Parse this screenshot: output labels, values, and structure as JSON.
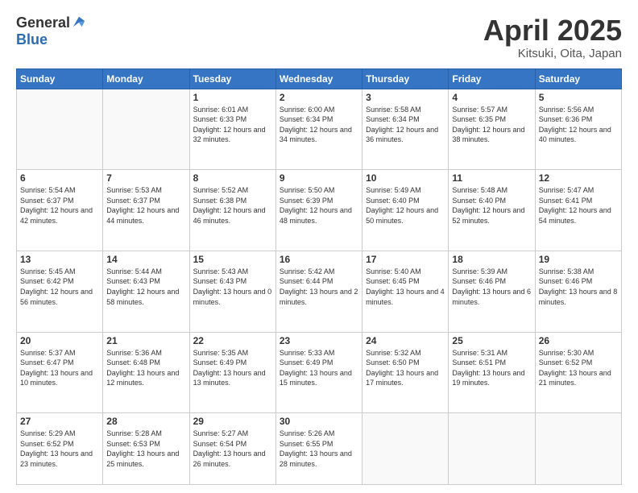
{
  "header": {
    "logo_general": "General",
    "logo_blue": "Blue",
    "month_title": "April 2025",
    "location": "Kitsuki, Oita, Japan"
  },
  "weekdays": [
    "Sunday",
    "Monday",
    "Tuesday",
    "Wednesday",
    "Thursday",
    "Friday",
    "Saturday"
  ],
  "weeks": [
    [
      {
        "day": "",
        "sunrise": "",
        "sunset": "",
        "daylight": ""
      },
      {
        "day": "",
        "sunrise": "",
        "sunset": "",
        "daylight": ""
      },
      {
        "day": "1",
        "sunrise": "Sunrise: 6:01 AM",
        "sunset": "Sunset: 6:33 PM",
        "daylight": "Daylight: 12 hours and 32 minutes."
      },
      {
        "day": "2",
        "sunrise": "Sunrise: 6:00 AM",
        "sunset": "Sunset: 6:34 PM",
        "daylight": "Daylight: 12 hours and 34 minutes."
      },
      {
        "day": "3",
        "sunrise": "Sunrise: 5:58 AM",
        "sunset": "Sunset: 6:34 PM",
        "daylight": "Daylight: 12 hours and 36 minutes."
      },
      {
        "day": "4",
        "sunrise": "Sunrise: 5:57 AM",
        "sunset": "Sunset: 6:35 PM",
        "daylight": "Daylight: 12 hours and 38 minutes."
      },
      {
        "day": "5",
        "sunrise": "Sunrise: 5:56 AM",
        "sunset": "Sunset: 6:36 PM",
        "daylight": "Daylight: 12 hours and 40 minutes."
      }
    ],
    [
      {
        "day": "6",
        "sunrise": "Sunrise: 5:54 AM",
        "sunset": "Sunset: 6:37 PM",
        "daylight": "Daylight: 12 hours and 42 minutes."
      },
      {
        "day": "7",
        "sunrise": "Sunrise: 5:53 AM",
        "sunset": "Sunset: 6:37 PM",
        "daylight": "Daylight: 12 hours and 44 minutes."
      },
      {
        "day": "8",
        "sunrise": "Sunrise: 5:52 AM",
        "sunset": "Sunset: 6:38 PM",
        "daylight": "Daylight: 12 hours and 46 minutes."
      },
      {
        "day": "9",
        "sunrise": "Sunrise: 5:50 AM",
        "sunset": "Sunset: 6:39 PM",
        "daylight": "Daylight: 12 hours and 48 minutes."
      },
      {
        "day": "10",
        "sunrise": "Sunrise: 5:49 AM",
        "sunset": "Sunset: 6:40 PM",
        "daylight": "Daylight: 12 hours and 50 minutes."
      },
      {
        "day": "11",
        "sunrise": "Sunrise: 5:48 AM",
        "sunset": "Sunset: 6:40 PM",
        "daylight": "Daylight: 12 hours and 52 minutes."
      },
      {
        "day": "12",
        "sunrise": "Sunrise: 5:47 AM",
        "sunset": "Sunset: 6:41 PM",
        "daylight": "Daylight: 12 hours and 54 minutes."
      }
    ],
    [
      {
        "day": "13",
        "sunrise": "Sunrise: 5:45 AM",
        "sunset": "Sunset: 6:42 PM",
        "daylight": "Daylight: 12 hours and 56 minutes."
      },
      {
        "day": "14",
        "sunrise": "Sunrise: 5:44 AM",
        "sunset": "Sunset: 6:43 PM",
        "daylight": "Daylight: 12 hours and 58 minutes."
      },
      {
        "day": "15",
        "sunrise": "Sunrise: 5:43 AM",
        "sunset": "Sunset: 6:43 PM",
        "daylight": "Daylight: 13 hours and 0 minutes."
      },
      {
        "day": "16",
        "sunrise": "Sunrise: 5:42 AM",
        "sunset": "Sunset: 6:44 PM",
        "daylight": "Daylight: 13 hours and 2 minutes."
      },
      {
        "day": "17",
        "sunrise": "Sunrise: 5:40 AM",
        "sunset": "Sunset: 6:45 PM",
        "daylight": "Daylight: 13 hours and 4 minutes."
      },
      {
        "day": "18",
        "sunrise": "Sunrise: 5:39 AM",
        "sunset": "Sunset: 6:46 PM",
        "daylight": "Daylight: 13 hours and 6 minutes."
      },
      {
        "day": "19",
        "sunrise": "Sunrise: 5:38 AM",
        "sunset": "Sunset: 6:46 PM",
        "daylight": "Daylight: 13 hours and 8 minutes."
      }
    ],
    [
      {
        "day": "20",
        "sunrise": "Sunrise: 5:37 AM",
        "sunset": "Sunset: 6:47 PM",
        "daylight": "Daylight: 13 hours and 10 minutes."
      },
      {
        "day": "21",
        "sunrise": "Sunrise: 5:36 AM",
        "sunset": "Sunset: 6:48 PM",
        "daylight": "Daylight: 13 hours and 12 minutes."
      },
      {
        "day": "22",
        "sunrise": "Sunrise: 5:35 AM",
        "sunset": "Sunset: 6:49 PM",
        "daylight": "Daylight: 13 hours and 13 minutes."
      },
      {
        "day": "23",
        "sunrise": "Sunrise: 5:33 AM",
        "sunset": "Sunset: 6:49 PM",
        "daylight": "Daylight: 13 hours and 15 minutes."
      },
      {
        "day": "24",
        "sunrise": "Sunrise: 5:32 AM",
        "sunset": "Sunset: 6:50 PM",
        "daylight": "Daylight: 13 hours and 17 minutes."
      },
      {
        "day": "25",
        "sunrise": "Sunrise: 5:31 AM",
        "sunset": "Sunset: 6:51 PM",
        "daylight": "Daylight: 13 hours and 19 minutes."
      },
      {
        "day": "26",
        "sunrise": "Sunrise: 5:30 AM",
        "sunset": "Sunset: 6:52 PM",
        "daylight": "Daylight: 13 hours and 21 minutes."
      }
    ],
    [
      {
        "day": "27",
        "sunrise": "Sunrise: 5:29 AM",
        "sunset": "Sunset: 6:52 PM",
        "daylight": "Daylight: 13 hours and 23 minutes."
      },
      {
        "day": "28",
        "sunrise": "Sunrise: 5:28 AM",
        "sunset": "Sunset: 6:53 PM",
        "daylight": "Daylight: 13 hours and 25 minutes."
      },
      {
        "day": "29",
        "sunrise": "Sunrise: 5:27 AM",
        "sunset": "Sunset: 6:54 PM",
        "daylight": "Daylight: 13 hours and 26 minutes."
      },
      {
        "day": "30",
        "sunrise": "Sunrise: 5:26 AM",
        "sunset": "Sunset: 6:55 PM",
        "daylight": "Daylight: 13 hours and 28 minutes."
      },
      {
        "day": "",
        "sunrise": "",
        "sunset": "",
        "daylight": ""
      },
      {
        "day": "",
        "sunrise": "",
        "sunset": "",
        "daylight": ""
      },
      {
        "day": "",
        "sunrise": "",
        "sunset": "",
        "daylight": ""
      }
    ]
  ]
}
